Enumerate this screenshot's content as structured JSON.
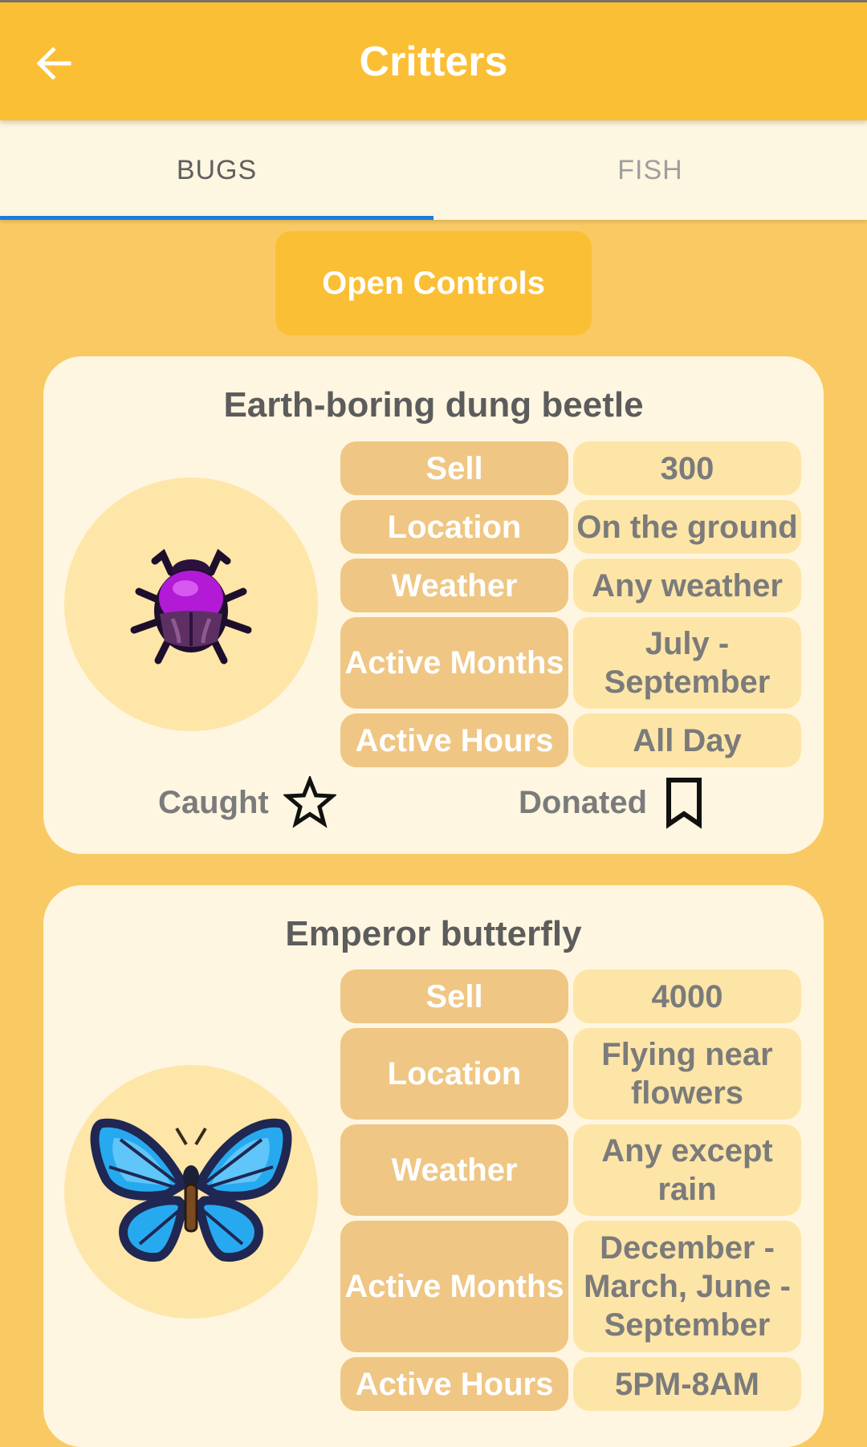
{
  "appbar": {
    "title": "Critters",
    "back_icon": "arrow-left-icon"
  },
  "tabs": [
    {
      "label": "BUGS",
      "selected": true
    },
    {
      "label": "FISH",
      "selected": false
    }
  ],
  "controls": {
    "open_label": "Open Controls"
  },
  "colors": {
    "accent": "#fbbf35",
    "background": "#f9ca63",
    "card": "#fef6e0",
    "tab_indicator": "#1e7be0",
    "label_cell": "#efc683",
    "value_cell": "#fde5a7"
  },
  "critters": [
    {
      "name": "Earth-boring dung beetle",
      "icon": "dung-beetle-icon",
      "rows": [
        {
          "label": "Sell",
          "value": "300"
        },
        {
          "label": "Location",
          "value": "On the ground"
        },
        {
          "label": "Weather",
          "value": "Any weather"
        },
        {
          "label": "Active Months",
          "value": "July - September"
        },
        {
          "label": "Active Hours",
          "value": "All Day"
        }
      ],
      "caught_label": "Caught",
      "donated_label": "Donated"
    },
    {
      "name": "Emperor butterfly",
      "icon": "butterfly-icon",
      "rows": [
        {
          "label": "Sell",
          "value": "4000"
        },
        {
          "label": "Location",
          "value": "Flying near flowers"
        },
        {
          "label": "Weather",
          "value": "Any except rain"
        },
        {
          "label": "Active Months",
          "value": "December - March, June - September"
        },
        {
          "label": "Active Hours",
          "value": "5PM-8AM"
        }
      ]
    }
  ]
}
